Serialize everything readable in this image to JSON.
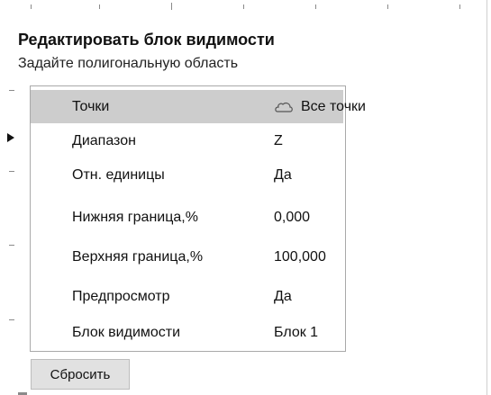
{
  "header": {
    "title": "Редактировать блок видимости",
    "subtitle": "Задайте полигональную область"
  },
  "properties": [
    {
      "label": "Точки",
      "value": "Все точки",
      "icon": "cloud-icon",
      "selected": true
    },
    {
      "label": "Диапазон",
      "value": "Z",
      "current": true
    },
    {
      "label": "Отн. единицы",
      "value": "Да"
    },
    {
      "label": "Нижняя граница,%",
      "value": "0,000"
    },
    {
      "label": "Верхняя граница,%",
      "value": "100,000"
    },
    {
      "label": "Предпросмотр",
      "value": "Да"
    },
    {
      "label": "Блок видимости",
      "value": "Блок 1"
    }
  ],
  "actions": {
    "reset_label": "Сбросить"
  },
  "colors": {
    "selected_row": "#cdcdcd",
    "panel_border": "#a9a9a9",
    "button_bg": "#e1e1e1"
  }
}
